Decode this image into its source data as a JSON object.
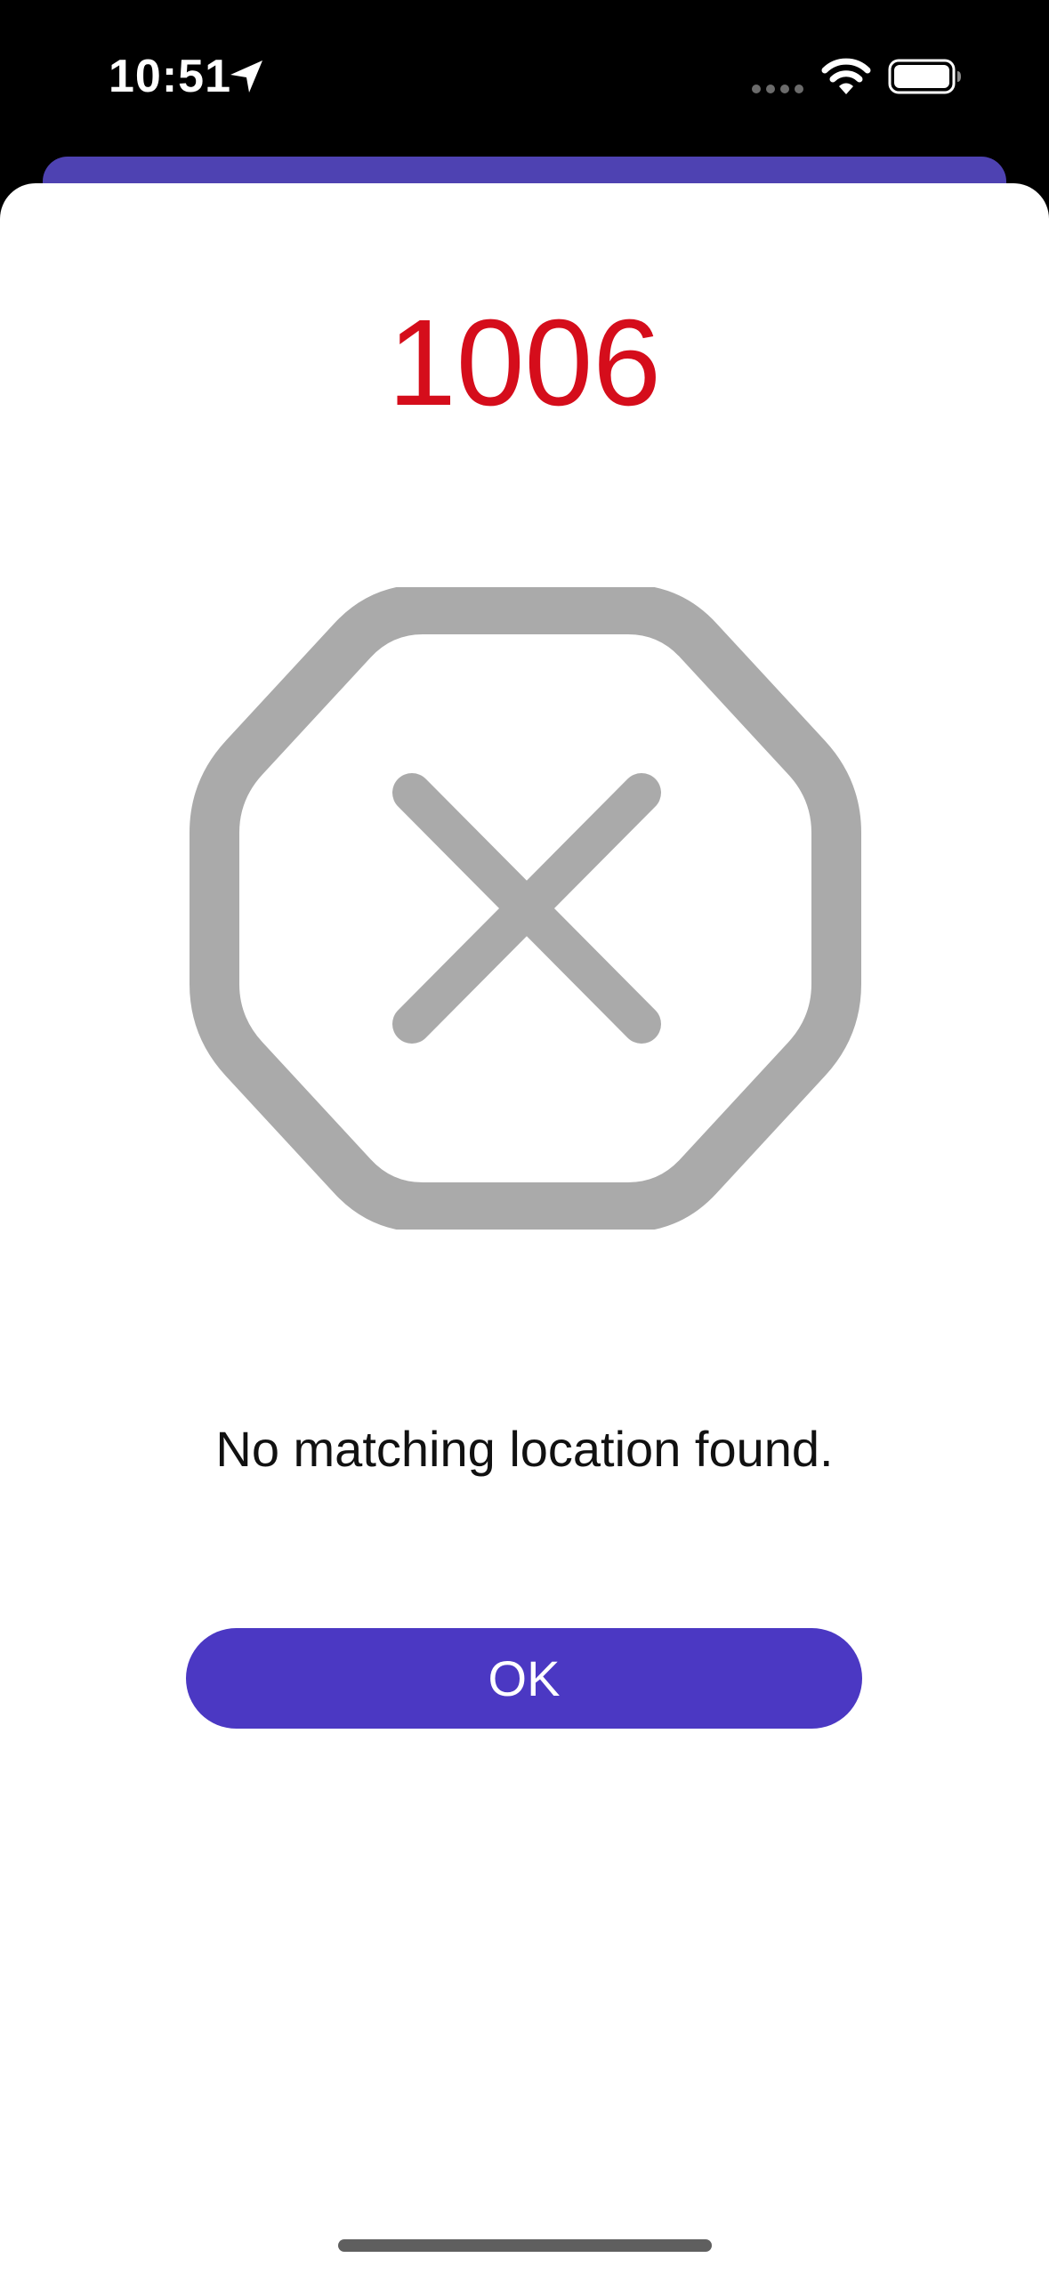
{
  "status_bar": {
    "time": "10:51",
    "icons": [
      "location-arrow-icon",
      "cellular-signal-icon",
      "wifi-icon",
      "battery-icon"
    ]
  },
  "alert": {
    "code": "1006",
    "icon": "xmark-octagon-icon",
    "message": "No matching location found.",
    "ok_label": "OK"
  },
  "colors": {
    "code_red": "#d50d1b",
    "accent_purple": "#4b38c3",
    "back_sheet_purple": "#4e42b2",
    "icon_gray": "#aaaaaa"
  }
}
